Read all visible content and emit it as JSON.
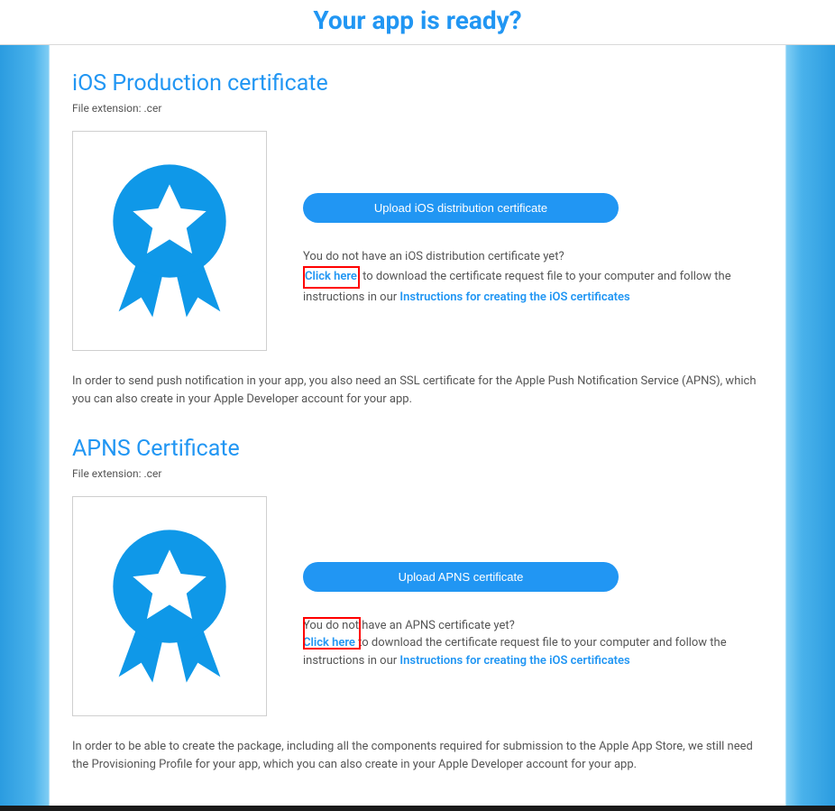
{
  "header": {
    "title": "Your app is ready?"
  },
  "sections": {
    "ios_prod": {
      "title": "iOS Production certificate",
      "file_ext": "File extension: .cer",
      "button": "Upload iOS distribution certificate",
      "q": "You do not have an iOS distribution certificate yet?",
      "click_here": "Click here",
      "mid1": " to download the certificate request file to your computer and follow the instructions in our ",
      "instr_link": "Instructions for creating the iOS certificates",
      "after_para": "In order to send push notification in your app, you also need an SSL certificate for the Apple Push Notification Service (APNS), which you can also create in your Apple Developer account for your app."
    },
    "apns": {
      "title": "APNS Certificate",
      "file_ext": "File extension: .cer",
      "button": "Upload APNS certificate",
      "q_pre": "You do not ",
      "q_mid_boxed_part": "have an APNS certificate yet?",
      "click_here": "Click here",
      "mid1": " to download the certificate request file to your computer and follow the instructions in our ",
      "instr_link": "Instructions for creating the iOS certificates",
      "after_para": "In order to be able to create the package, including all the components required for submission to the Apple App Store, we still need the Provisioning Profile for your app, which you can also create in your Apple Developer account for your app."
    }
  },
  "colors": {
    "accent": "#2196f3"
  }
}
